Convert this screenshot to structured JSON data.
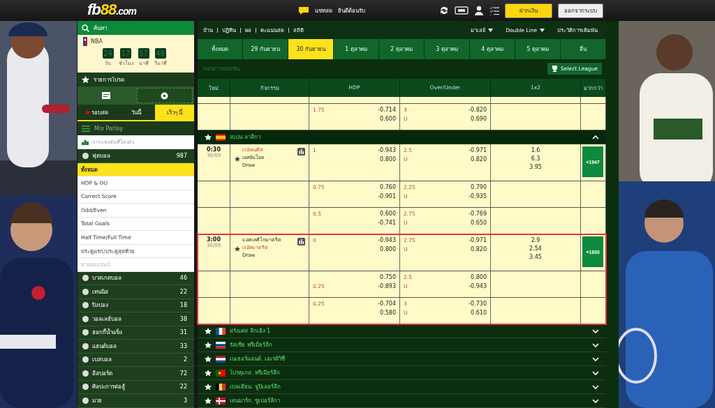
{
  "header": {
    "logo": [
      "fb",
      "88",
      ".com"
    ],
    "chat": "แชทสด",
    "welcome": "ยินดีต้อนรับ",
    "buttons": [
      {
        "label": "ฝากเงิน",
        "kind": "primary"
      },
      {
        "label": "ออกจากระบบ",
        "kind": "secondary"
      }
    ]
  },
  "sidebar": {
    "search": "ค้นหา",
    "event": {
      "name": "NBA",
      "timer": [
        {
          "value": "24",
          "unit": "วัน"
        },
        {
          "value": "17",
          "unit": "ชั่วโมง"
        },
        {
          "value": "57",
          "unit": "นาที"
        },
        {
          "value": "48",
          "unit": "วินาที"
        }
      ]
    },
    "favorites": "รายการโปรด",
    "tabs": [
      {
        "label": "รอบสด",
        "live": true,
        "selected": false
      },
      {
        "label": "วันนี้",
        "live": false,
        "selected": false
      },
      {
        "label": "เร็วๆ นี้",
        "live": false,
        "selected": true
      }
    ],
    "mix_parlay": "Mix Parlay",
    "popular": "การแข่งขันที่โด่งดัง",
    "football": {
      "name": "ฟุตบอล",
      "count": "987",
      "markets": [
        {
          "label": "ทั้งหมด",
          "selected": true,
          "disabled": false
        },
        {
          "label": "HDP & OU",
          "selected": false,
          "disabled": false
        },
        {
          "label": "Correct Score",
          "selected": false,
          "disabled": false
        },
        {
          "label": "Odd/Even",
          "selected": false,
          "disabled": false
        },
        {
          "label": "Total Goals",
          "selected": false,
          "disabled": false
        },
        {
          "label": "Half Time/Full Time",
          "selected": false,
          "disabled": false
        },
        {
          "label": "ประตูแรก/ประตูสุดท้าย",
          "selected": false,
          "disabled": false
        },
        {
          "label": "ทายผลแชมป์",
          "selected": false,
          "disabled": true
        }
      ]
    },
    "sports": [
      {
        "name": "บาสเกตบอล",
        "count": "46"
      },
      {
        "name": "เทนนิส",
        "count": "22"
      },
      {
        "name": "ปิงปอง",
        "count": "18"
      },
      {
        "name": "วอลเลย์บอล",
        "count": "38"
      },
      {
        "name": "ฮอกกี้น้ำแข็ง",
        "count": "31"
      },
      {
        "name": "แฮนด์บอล",
        "count": "33"
      },
      {
        "name": "เบสบอล",
        "count": "2"
      },
      {
        "name": "อีสปอร์ต",
        "count": "72"
      },
      {
        "name": "ศิลปะการต่อสู้",
        "count": "22"
      },
      {
        "name": "มวย",
        "count": "3"
      }
    ]
  },
  "nav": {
    "links": [
      "บ้าน",
      "ปฏิทิน",
      "ผล",
      "คะแนนสด",
      "สถิติ"
    ],
    "dropdowns": [
      "มาเลย์",
      "Double Line"
    ],
    "history": "ประวัติการเดิมพัน"
  },
  "date_tabs": [
    {
      "label": "ทั้งหมด",
      "selected": false
    },
    {
      "label": "29 กันยายน",
      "selected": false
    },
    {
      "label": "30 กันยายน",
      "selected": true
    },
    {
      "label": "1 ตุลาคม",
      "selected": false
    },
    {
      "label": "2 ตุลาคม",
      "selected": false
    },
    {
      "label": "3 ตุลาคม",
      "selected": false
    },
    {
      "label": "4 ตุลาคม",
      "selected": false
    },
    {
      "label": "5 ตุลาคม",
      "selected": false
    },
    {
      "label": "อื่น",
      "selected": false
    }
  ],
  "section_title": "ก่อนการแข่งขัน",
  "select_league": "Select League",
  "table": {
    "columns": [
      "ใหม่",
      "กิจกรรม",
      "HDP",
      "Over/Under",
      "1x2",
      "มากกว่า"
    ],
    "top_lines": [
      {
        "hdp": {
          "line": "1.75",
          "first": "-0.714",
          "second": "0.600"
        },
        "ou": {
          "line": "3",
          "under": "U",
          "first": "-0.820",
          "second": "0.690"
        }
      }
    ],
    "leagues": [
      {
        "name": "สเปน ลาลีกา",
        "kind": "spain",
        "expanded": true,
        "matches": [
          {
            "time": "0:30",
            "date": "30/09",
            "highlighted": false,
            "teams": [
              {
                "name": "เรอัลเบติส",
                "favorite": true
              },
              {
                "name": "เอสปันโยล",
                "favorite": false
              }
            ],
            "draw": "Draw",
            "x12": [
              "1.6",
              "6.3",
              "3.95"
            ],
            "more": "+1947",
            "lines": [
              {
                "hdp": {
                  "line": "1",
                  "first": "-0.943",
                  "second": "0.800"
                },
                "ou": {
                  "line": "2.5",
                  "under": "U",
                  "first": "-0.971",
                  "second": "0.820"
                }
              },
              {
                "hdp": {
                  "line": "0.75",
                  "first": "0.760",
                  "second": "-0.901"
                },
                "ou": {
                  "line": "2.25",
                  "under": "U",
                  "first": "0.790",
                  "second": "-0.935"
                }
              },
              {
                "hdp": {
                  "line": "0.5",
                  "first": "0.600",
                  "second": "-0.741"
                },
                "ou": {
                  "line": "2.75",
                  "under": "U",
                  "first": "-0.769",
                  "second": "0.650"
                }
              }
            ]
          },
          {
            "time": "3:00",
            "date": "30/09",
            "highlighted": true,
            "teams": [
              {
                "name": "แอตเลติโกมาดริด",
                "favorite": false
              },
              {
                "name": "เรอัลมาดริด",
                "favorite": true
              }
            ],
            "draw": "Draw",
            "x12": [
              "2.9",
              "2.54",
              "3.45"
            ],
            "more": "+1830",
            "lines": [
              {
                "hdp": {
                  "line": "0",
                  "first": "-0.943",
                  "second": "0.800"
                },
                "ou": {
                  "line": "2.75",
                  "under": "U",
                  "first": "-0.971",
                  "second": "0.820"
                }
              },
              {
                "hdp": {
                  "second_line": "0.25",
                  "first": "0.750",
                  "second": "-0.893"
                },
                "ou": {
                  "line": "2.5",
                  "under": "U",
                  "first": "0.800",
                  "second": "-0.943"
                }
              },
              {
                "hdp": {
                  "line": "0.25",
                  "first": "-0.704",
                  "second": "0.580"
                },
                "ou": {
                  "line": "3",
                  "under": "U",
                  "first": "-0.730",
                  "second": "0.610"
                }
              }
            ]
          }
        ]
      },
      {
        "name": "ฝรั่งเศส ลีกเอิง 1",
        "kind": "france",
        "expanded": false
      },
      {
        "name": "รัสเซีย พรีเมียร์ลีก",
        "kind": "russia",
        "expanded": false
      },
      {
        "name": "เนเธอร์แลนด์. เอเรดิวิซี่",
        "kind": "netherlands",
        "expanded": false
      },
      {
        "name": "โปรตุเกส. พรีเมียร์ลีก",
        "kind": "portugal",
        "expanded": false
      },
      {
        "name": "เบลเยียม. จูปิเลอร์ลีก",
        "kind": "belgium",
        "expanded": false
      },
      {
        "name": "เดนมาร์ก. ซูเปอร์ลีกา",
        "kind": "denmark",
        "expanded": false
      }
    ]
  }
}
